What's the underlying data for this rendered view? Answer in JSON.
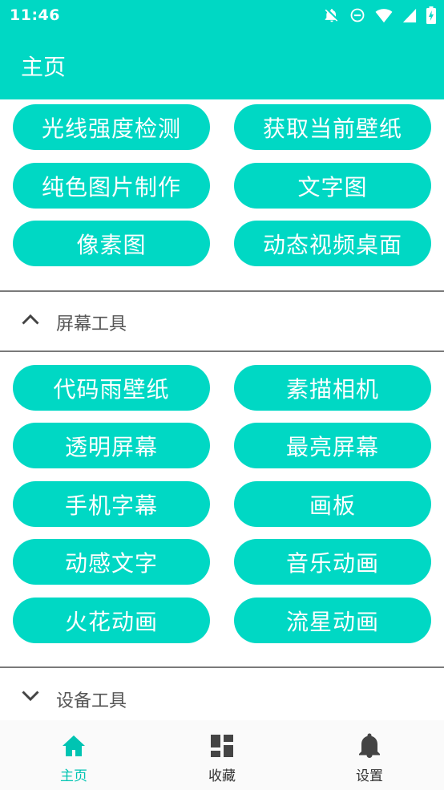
{
  "status_bar": {
    "time": "11:46",
    "icons": [
      "notifications-off-icon",
      "do-not-disturb-icon",
      "wifi-icon",
      "cellular-signal-icon",
      "battery-charging-icon"
    ]
  },
  "app_bar": {
    "title": "主页"
  },
  "colors": {
    "accent": "#00d8c4",
    "divider": "#7a7a7a",
    "active_nav": "#00c4b2"
  },
  "top_section": {
    "buttons": [
      "光线强度检测",
      "获取当前壁纸",
      "纯色图片制作",
      "文字图",
      "像素图",
      "动态视频桌面"
    ]
  },
  "screen_tools": {
    "title": "屏幕工具",
    "expanded": true,
    "buttons": [
      "代码雨壁纸",
      "素描相机",
      "透明屏幕",
      "最亮屏幕",
      "手机字幕",
      "画板",
      "动感文字",
      "音乐动画",
      "火花动画",
      "流星动画"
    ]
  },
  "device_tools": {
    "title": "设备工具",
    "expanded": false
  },
  "bottom_nav": {
    "items": [
      {
        "label": "主页",
        "icon": "home-icon",
        "active": true
      },
      {
        "label": "收藏",
        "icon": "dashboard-icon",
        "active": false
      },
      {
        "label": "设置",
        "icon": "bell-icon",
        "active": false
      }
    ]
  }
}
